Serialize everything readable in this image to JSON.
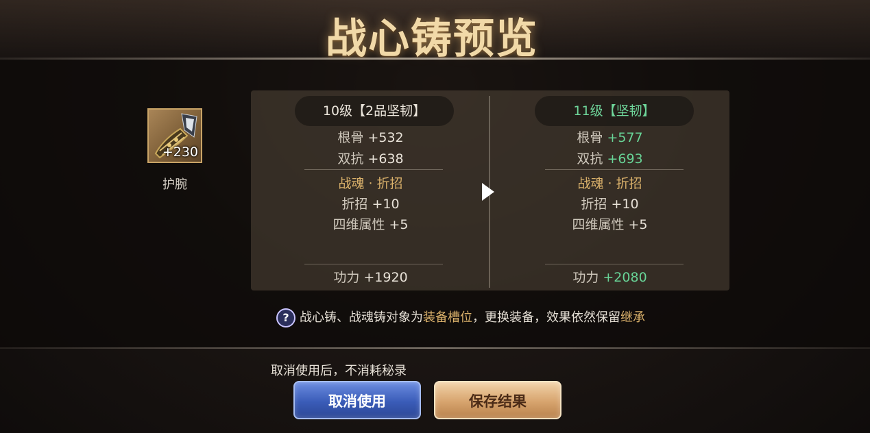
{
  "title": "战心铸预览",
  "item": {
    "name": "护腕",
    "level": "+230",
    "icon": "bracer-icon"
  },
  "current": {
    "header": "10级【2品坚韧】",
    "stats": [
      {
        "label": "根骨",
        "value": "+532"
      },
      {
        "label": "双抗",
        "value": "+638"
      }
    ],
    "skill_title": "战魂 · 折招",
    "skill_stats": [
      {
        "label": "折招",
        "value": "+10"
      },
      {
        "label": "四维属性",
        "value": "+5"
      }
    ],
    "power": {
      "label": "功力",
      "value": "+1920"
    }
  },
  "preview": {
    "header": "11级【坚韧】",
    "stats": [
      {
        "label": "根骨",
        "value": "+577"
      },
      {
        "label": "双抗",
        "value": "+693"
      }
    ],
    "skill_title": "战魂 · 折招",
    "skill_stats": [
      {
        "label": "折招",
        "value": "+10"
      },
      {
        "label": "四维属性",
        "value": "+5"
      }
    ],
    "power": {
      "label": "功力",
      "value": "+2080"
    }
  },
  "hint": {
    "help_symbol": "?",
    "part1": "战心铸、战魂铸对象为",
    "highlight1": "装备槽位",
    "part2": "，更换装备，效果依然保留",
    "highlight2": "继承"
  },
  "cancel_note": "取消使用后，不消耗秘录",
  "buttons": {
    "cancel": "取消使用",
    "save": "保存结果"
  },
  "colors": {
    "title": "#f1d9a8",
    "increase": "#68d497",
    "gold_text": "#d9b06a",
    "cancel_button": "#3a5cb8",
    "save_button": "#d7a46e"
  }
}
